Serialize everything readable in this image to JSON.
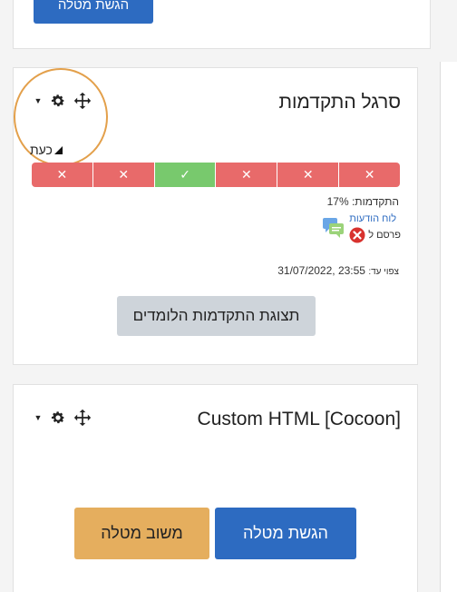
{
  "top_card": {
    "button_label": "הגשת מטלה"
  },
  "progress_block": {
    "title": "סרגל התקדמות",
    "now_label": "כעת",
    "cells": [
      {
        "status": "incomplete",
        "symbol": "✕"
      },
      {
        "status": "incomplete",
        "symbol": "✕"
      },
      {
        "status": "complete",
        "symbol": "✓"
      },
      {
        "status": "incomplete",
        "symbol": "✕"
      },
      {
        "status": "incomplete",
        "symbol": "✕"
      },
      {
        "status": "incomplete",
        "symbol": "✕"
      }
    ],
    "progress_text": "התקדמות: 17%",
    "forum_link": "לוח הודעות",
    "posted_text": "פרסם ל",
    "due_label": "צפוי עד:",
    "due_date": "31/07/2022, 23:55",
    "overview_button": "תצוגת התקדמות הלומדים"
  },
  "custom_block": {
    "title": "Custom HTML [Cocoon]",
    "submit_button": "הגשת מטלה",
    "feedback_button": "משוב מטלה"
  },
  "colors": {
    "accent_blue": "#2d6bc1",
    "incomplete_red": "#e86a6a",
    "complete_green": "#78c96d",
    "feedback_orange": "#e5ae5e",
    "highlight_ring": "#e3a04b"
  },
  "icons": {
    "block_controls": [
      "caret-down-icon",
      "gear-icon",
      "move-icon"
    ],
    "forum": "forum-chat-icon",
    "not_done": "x-circle-icon"
  }
}
